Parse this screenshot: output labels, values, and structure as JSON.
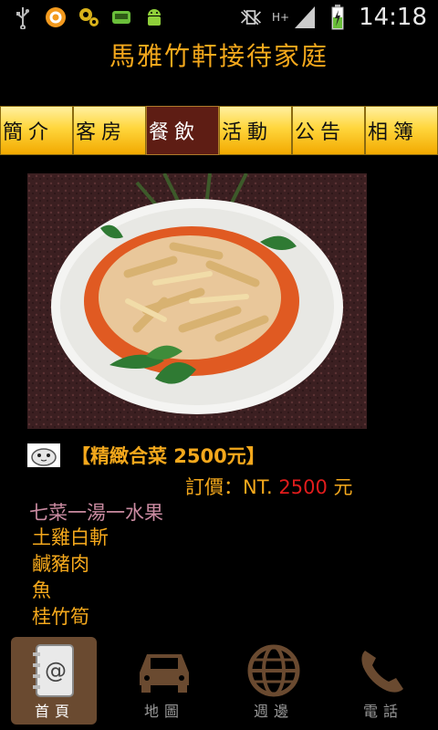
{
  "statusbar": {
    "time": "14:18",
    "network": "H+",
    "icons": [
      "usb-icon",
      "app-notification-icon",
      "settings-notification-icon",
      "android-icon",
      "android-robot-icon",
      "no-vibrate-icon",
      "signal-icon",
      "battery-icon"
    ]
  },
  "app": {
    "title": "馬雅竹軒接待家庭"
  },
  "tabs": [
    {
      "label": "簡介",
      "active": false
    },
    {
      "label": "客房",
      "active": false
    },
    {
      "label": "餐飲",
      "active": true
    },
    {
      "label": "活動",
      "active": false
    },
    {
      "label": "公告",
      "active": false
    },
    {
      "label": "相簿",
      "active": false
    }
  ],
  "menu": {
    "title": "【精緻合菜 2500元】",
    "price_prefix": "訂價：NT. ",
    "price_value": "2500",
    "price_suffix": " 元",
    "course_line": "七菜一湯一水果",
    "dishes": [
      "土雞白斬",
      "鹹豬肉",
      "魚",
      "桂竹筍"
    ]
  },
  "bottomnav": [
    {
      "label": "首頁",
      "icon": "contact-book-icon",
      "active": true
    },
    {
      "label": "地圖",
      "icon": "car-icon",
      "active": false
    },
    {
      "label": "週邊",
      "icon": "globe-icon",
      "active": false
    },
    {
      "label": "電話",
      "icon": "phone-icon",
      "active": false
    }
  ],
  "colors": {
    "accent": "#f4a81c",
    "price": "#e11c1c",
    "course": "#c98aa0",
    "tab_active": "#5e1d14",
    "nav_active": "#6a4a30"
  }
}
